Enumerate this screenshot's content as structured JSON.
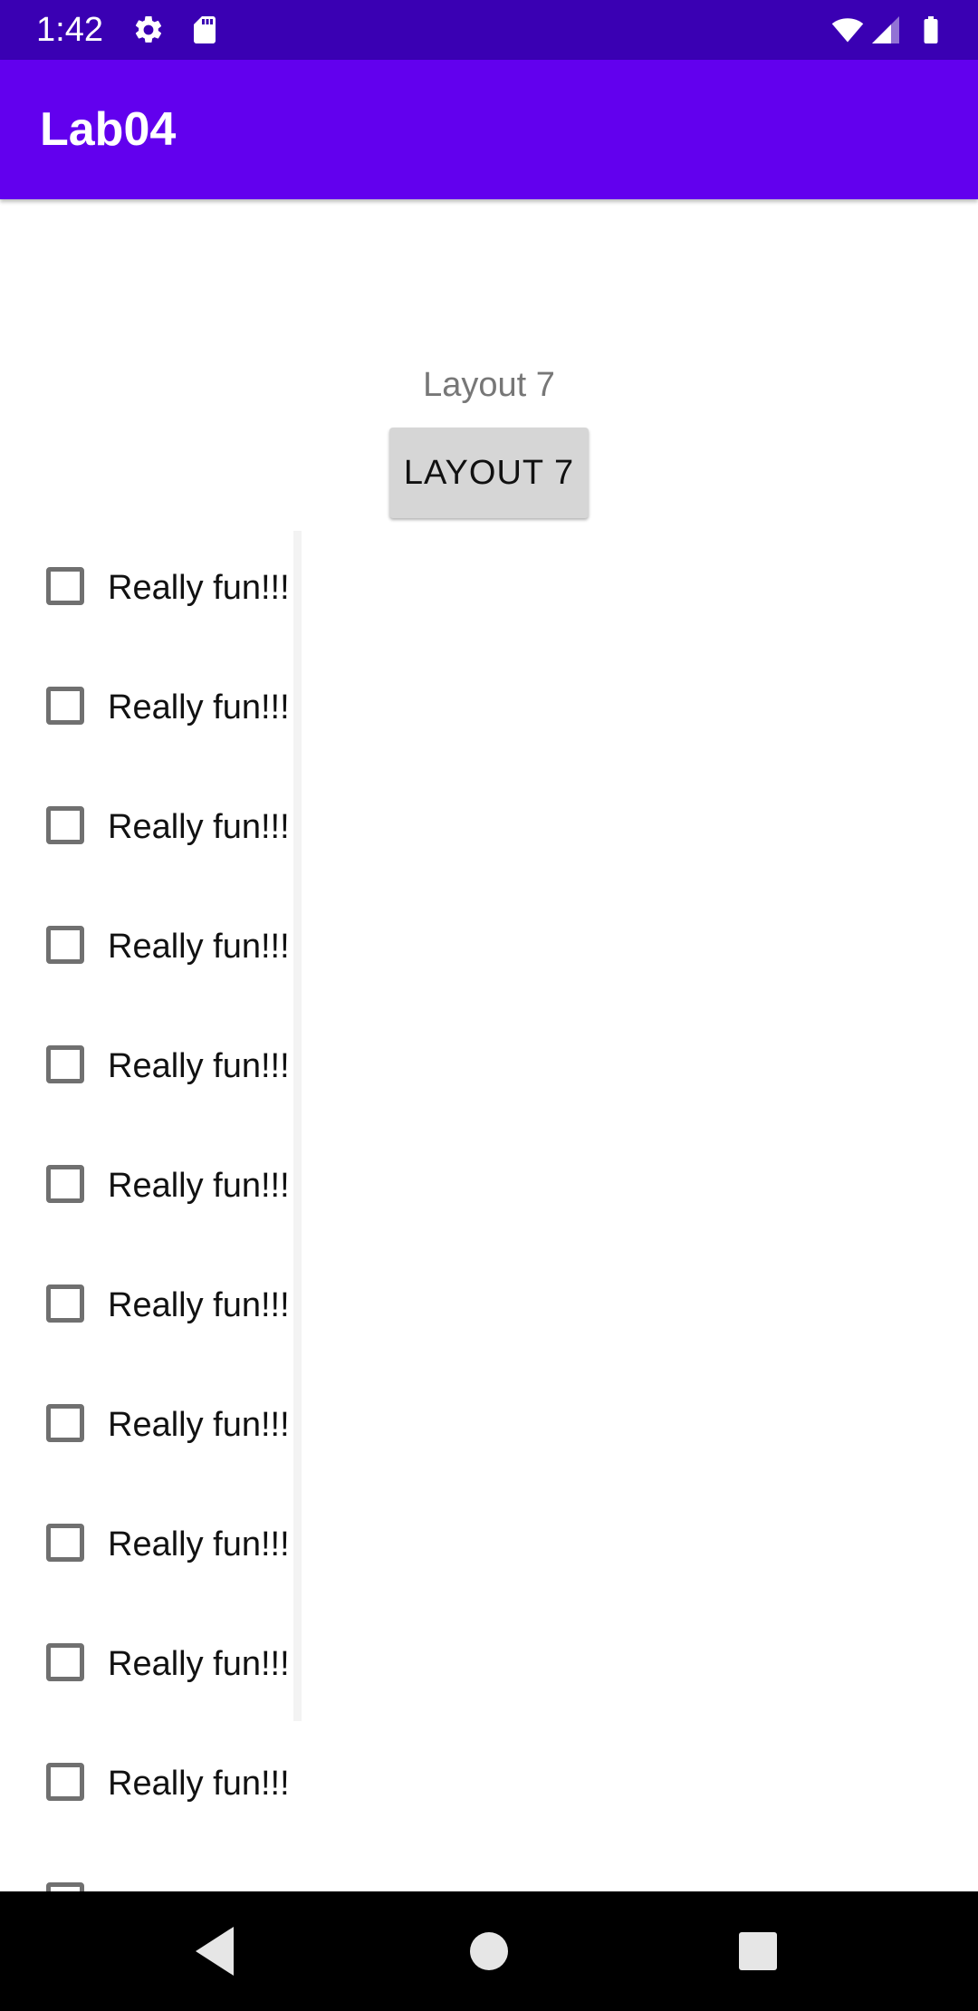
{
  "status_bar": {
    "time": "1:42",
    "icons_left": [
      "gear-icon",
      "sd-card-icon"
    ],
    "icons_right": [
      "wifi-icon",
      "signal-icon",
      "battery-icon"
    ],
    "background": "#3a00b3"
  },
  "app_bar": {
    "title": "Lab04",
    "background": "#6200ee"
  },
  "main": {
    "layout_label": "Layout 7",
    "layout_button": "LAYOUT 7"
  },
  "checklist": {
    "items": [
      {
        "label": "Really fun!!!",
        "checked": false
      },
      {
        "label": "Really fun!!!",
        "checked": false
      },
      {
        "label": "Really fun!!!",
        "checked": false
      },
      {
        "label": "Really fun!!!",
        "checked": false
      },
      {
        "label": "Really fun!!!",
        "checked": false
      },
      {
        "label": "Really fun!!!",
        "checked": false
      },
      {
        "label": "Really fun!!!",
        "checked": false
      },
      {
        "label": "Really fun!!!",
        "checked": false
      },
      {
        "label": "Really fun!!!",
        "checked": false
      },
      {
        "label": "Really fun!!!",
        "checked": false
      },
      {
        "label": "Really fun!!!",
        "checked": false
      },
      {
        "label": "",
        "checked": false
      }
    ]
  },
  "nav_bar": {
    "buttons": [
      "back-icon",
      "home-icon",
      "recents-icon"
    ]
  }
}
